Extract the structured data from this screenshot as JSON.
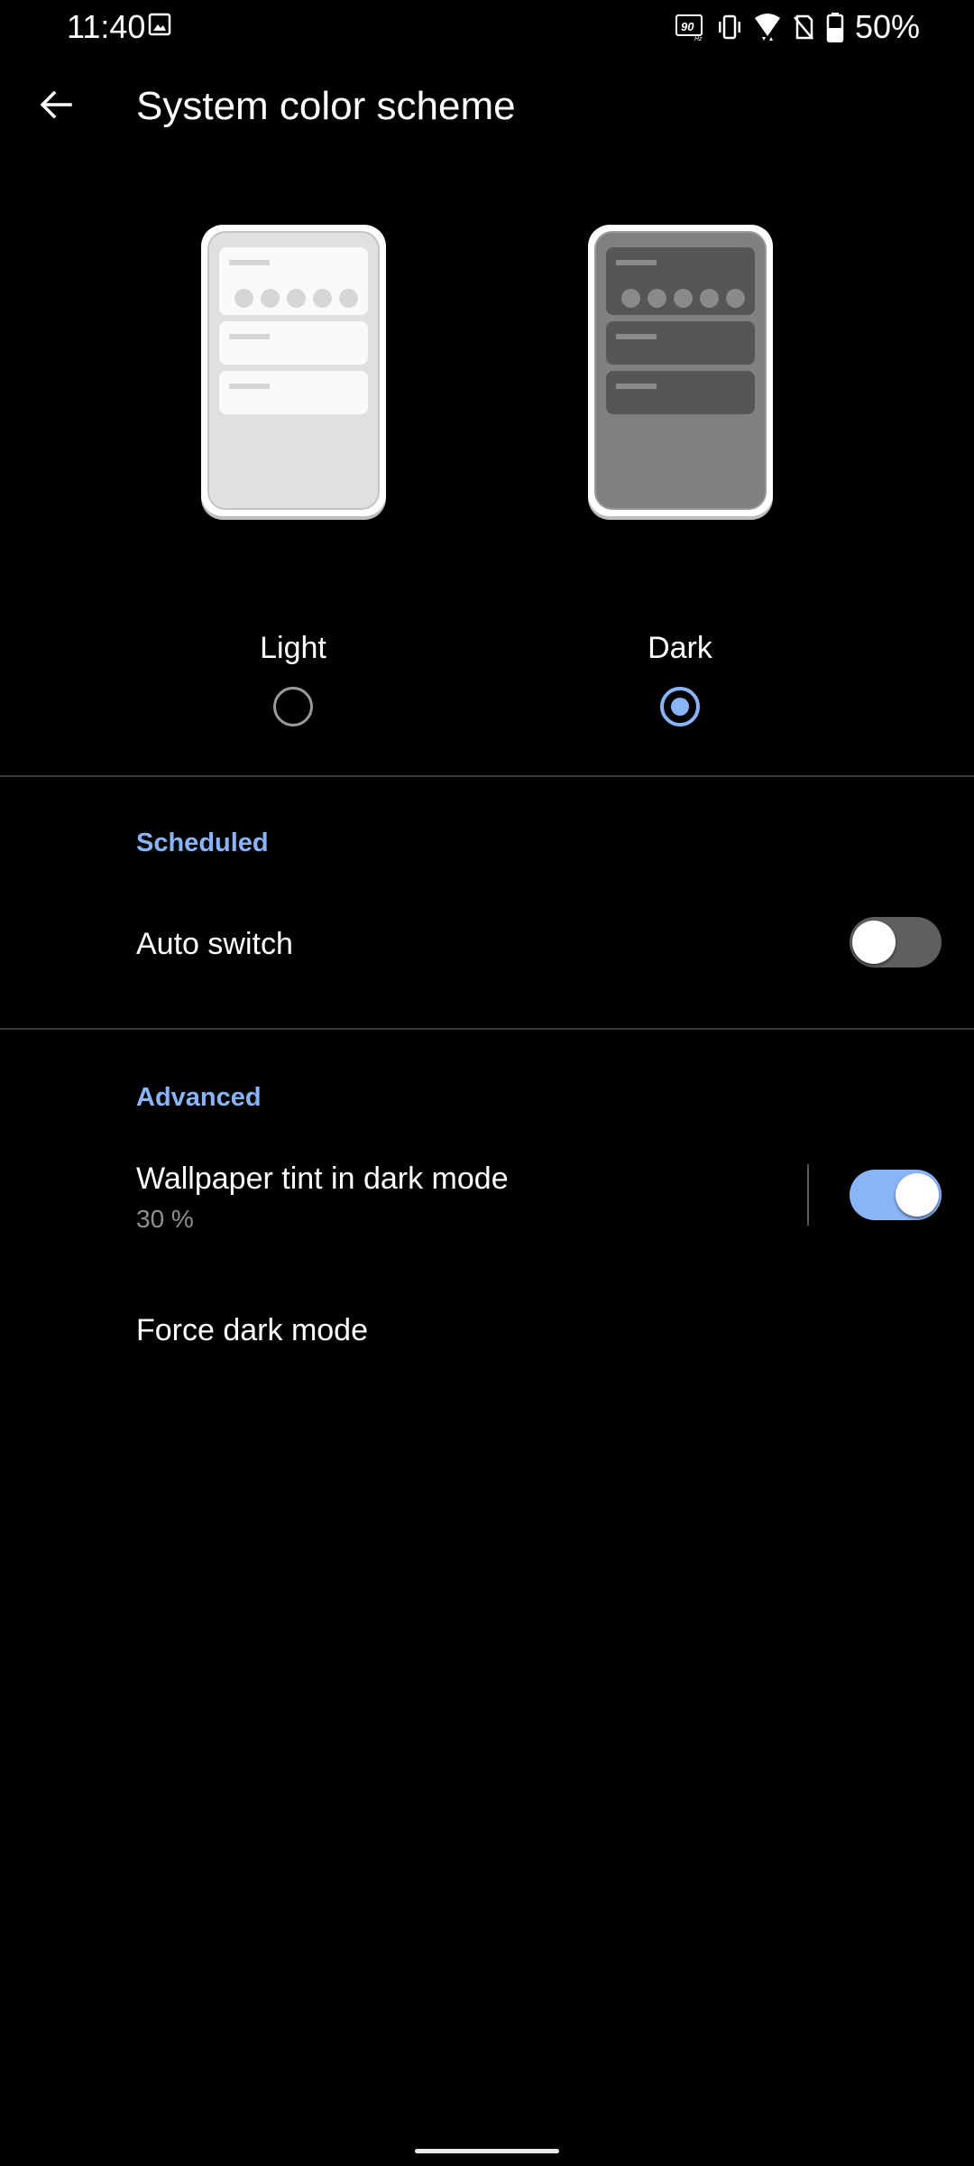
{
  "status_bar": {
    "time": "11:40",
    "battery_percent": "50%",
    "icons": [
      "gallery-icon",
      "refresh-rate-90hz-icon",
      "vibrate-icon",
      "wifi-icon",
      "no-sim-icon",
      "battery-icon"
    ],
    "refresh_rate_label": "90"
  },
  "app_bar": {
    "title": "System color scheme",
    "back_icon": "arrow-back-icon"
  },
  "theme_options": [
    {
      "label": "Light",
      "selected": false
    },
    {
      "label": "Dark",
      "selected": true
    }
  ],
  "sections": {
    "scheduled": {
      "header": "Scheduled",
      "items": [
        {
          "title": "Auto switch",
          "switch_on": false
        }
      ]
    },
    "advanced": {
      "header": "Advanced",
      "items": [
        {
          "title": "Wallpaper tint in dark mode",
          "summary": "30 %",
          "switch_on": true
        },
        {
          "title": "Force dark mode"
        }
      ]
    }
  },
  "colors": {
    "accent": "#8ab4f8",
    "background": "#000000",
    "switch_off_track": "#5f5f5f"
  }
}
